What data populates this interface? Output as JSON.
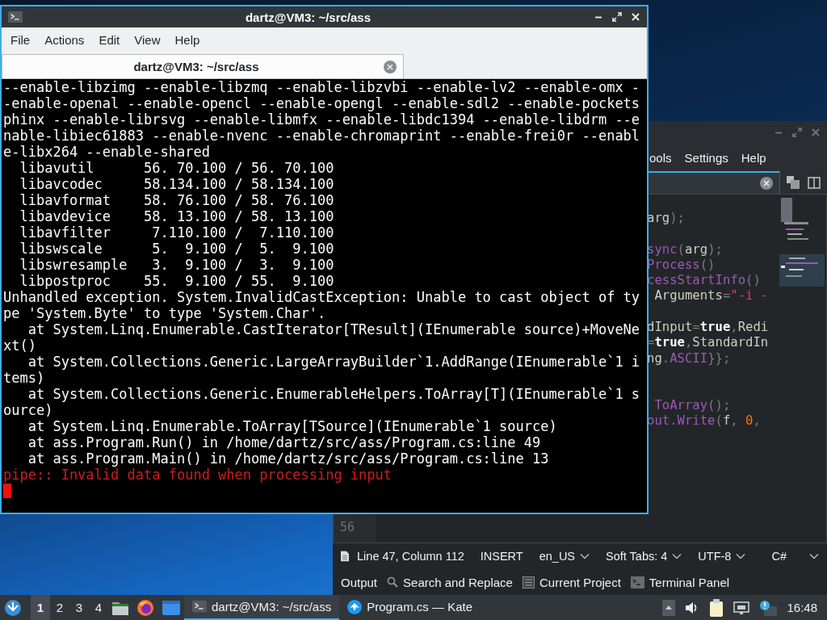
{
  "terminal_window": {
    "title": "dartz@VM3: ~/src/ass",
    "menu": [
      "File",
      "Actions",
      "Edit",
      "View",
      "Help"
    ],
    "tabs": [
      {
        "label": "dartz@VM3: ~/src/ass",
        "selected": true
      }
    ],
    "lines": [
      {
        "kind": "output",
        "text": "--enable-libzimg --enable-libzmq --enable-libzvbi --enable-lv2 --enable-omx -"
      },
      {
        "kind": "output",
        "text": "-enable-openal --enable-opencl --enable-opengl --enable-sdl2 --enable-pockets"
      },
      {
        "kind": "output",
        "text": "phinx --enable-librsvg --enable-libmfx --enable-libdc1394 --enable-libdrm --e"
      },
      {
        "kind": "output",
        "text": "nable-libiec61883 --enable-nvenc --enable-chromaprint --enable-frei0r --enabl"
      },
      {
        "kind": "output",
        "text": "e-libx264 --enable-shared"
      },
      {
        "kind": "output",
        "text": "  libavutil      56. 70.100 / 56. 70.100"
      },
      {
        "kind": "output",
        "text": "  libavcodec     58.134.100 / 58.134.100"
      },
      {
        "kind": "output",
        "text": "  libavformat    58. 76.100 / 58. 76.100"
      },
      {
        "kind": "output",
        "text": "  libavdevice    58. 13.100 / 58. 13.100"
      },
      {
        "kind": "output",
        "text": "  libavfilter     7.110.100 /  7.110.100"
      },
      {
        "kind": "output",
        "text": "  libswscale      5.  9.100 /  5.  9.100"
      },
      {
        "kind": "output",
        "text": "  libswresample   3.  9.100 /  3.  9.100"
      },
      {
        "kind": "output",
        "text": "  libpostproc    55.  9.100 / 55.  9.100"
      },
      {
        "kind": "output",
        "text": "Unhandled exception. System.InvalidCastException: Unable to cast object of ty"
      },
      {
        "kind": "output",
        "text": "pe 'System.Byte' to type 'System.Char'."
      },
      {
        "kind": "output",
        "text": "   at System.Linq.Enumerable.CastIterator[TResult](IEnumerable source)+MoveNe"
      },
      {
        "kind": "output",
        "text": "xt()"
      },
      {
        "kind": "output",
        "text": "   at System.Collections.Generic.LargeArrayBuilder`1.AddRange(IEnumerable`1 i"
      },
      {
        "kind": "output",
        "text": "tems)"
      },
      {
        "kind": "output",
        "text": "   at System.Collections.Generic.EnumerableHelpers.ToArray[T](IEnumerable`1 s"
      },
      {
        "kind": "output",
        "text": "ource)"
      },
      {
        "kind": "output",
        "text": "   at System.Linq.Enumerable.ToArray[TSource](IEnumerable`1 source)"
      },
      {
        "kind": "output",
        "text": "   at ass.Program.Run() in /home/dartz/src/ass/Program.cs:line 49"
      },
      {
        "kind": "output",
        "text": "   at ass.Program.Main() in /home/dartz/src/ass/Program.cs:line 13"
      },
      {
        "kind": "error",
        "text": "pipe:: Invalid data found when processing input"
      }
    ]
  },
  "editor_window": {
    "menu": [
      "ools",
      "Settings",
      "Help"
    ],
    "code_lines": [
      {
        "kind": "code",
        "tokens": [
          {
            "kind": "plain",
            "text": "arg"
          },
          {
            "kind": "punct",
            "text": ");"
          }
        ]
      },
      {
        "kind": "blank"
      },
      {
        "kind": "code",
        "tokens": [
          {
            "kind": "name",
            "text": "sync"
          },
          {
            "kind": "punct",
            "text": "("
          },
          {
            "kind": "plain",
            "text": "arg"
          },
          {
            "kind": "punct",
            "text": ");"
          }
        ]
      },
      {
        "kind": "code",
        "tokens": [
          {
            "kind": "name",
            "text": "Process"
          },
          {
            "kind": "punct",
            "text": "()"
          }
        ]
      },
      {
        "kind": "code",
        "tokens": [
          {
            "kind": "name",
            "text": "cessStartInfo"
          },
          {
            "kind": "punct",
            "text": "()"
          }
        ]
      },
      {
        "kind": "code",
        "tokens": [
          {
            "kind": "plain",
            "text": " Arguments"
          },
          {
            "kind": "punct",
            "text": "="
          },
          {
            "kind": "string",
            "text": "\"-i -"
          }
        ]
      },
      {
        "kind": "blank"
      },
      {
        "kind": "code",
        "tokens": [
          {
            "kind": "plain",
            "text": "dInput"
          },
          {
            "kind": "punct",
            "text": "="
          },
          {
            "kind": "keyword",
            "text": "true"
          },
          {
            "kind": "punct",
            "text": ","
          },
          {
            "kind": "plain",
            "text": "Redi"
          }
        ]
      },
      {
        "kind": "code",
        "tokens": [
          {
            "kind": "punct",
            "text": "="
          },
          {
            "kind": "keyword",
            "text": "true"
          },
          {
            "kind": "punct",
            "text": ","
          },
          {
            "kind": "plain",
            "text": "StandardIn"
          }
        ]
      },
      {
        "kind": "code",
        "tokens": [
          {
            "kind": "plain",
            "text": "ng"
          },
          {
            "kind": "punct",
            "text": "."
          },
          {
            "kind": "name",
            "text": "ASCII"
          },
          {
            "kind": "punct",
            "text": "}};"
          }
        ]
      },
      {
        "kind": "blank"
      },
      {
        "kind": "blank"
      },
      {
        "kind": "code",
        "tokens": [
          {
            "kind": "name",
            "text": " ToArray"
          },
          {
            "kind": "punct",
            "text": "();"
          }
        ]
      },
      {
        "kind": "code",
        "tokens": [
          {
            "kind": "name",
            "text": "out"
          },
          {
            "kind": "punct",
            "text": "."
          },
          {
            "kind": "name",
            "text": "Write"
          },
          {
            "kind": "punct",
            "text": "("
          },
          {
            "kind": "plain",
            "text": "f"
          },
          {
            "kind": "punct",
            "text": ", "
          },
          {
            "kind": "number",
            "text": "0"
          },
          {
            "kind": "punct",
            "text": ","
          }
        ]
      }
    ],
    "line_number": "56",
    "status_bar": {
      "position": "Line 47, Column 112",
      "mode": "INSERT",
      "dictionary": "en_US",
      "indentation": "Soft Tabs: 4",
      "encoding": "UTF-8",
      "syntax": "C#"
    },
    "tool_views": [
      {
        "kind": "plain",
        "label": "Output"
      },
      {
        "kind": "search",
        "label": "Search and Replace"
      },
      {
        "kind": "project",
        "label": "Current Project"
      },
      {
        "kind": "terminal",
        "label": "Terminal Panel"
      }
    ]
  },
  "taskbar": {
    "workspaces": [
      {
        "label": "1",
        "selected": true
      },
      {
        "label": "2",
        "selected": false
      },
      {
        "label": "3",
        "selected": false
      },
      {
        "label": "4",
        "selected": false
      }
    ],
    "tasks": [
      {
        "kind": "terminal",
        "label": "dartz@VM3: ~/src/ass",
        "selected": true
      },
      {
        "kind": "editor",
        "label": "Program.cs — Kate",
        "selected": false
      }
    ],
    "clock": "16:48"
  }
}
